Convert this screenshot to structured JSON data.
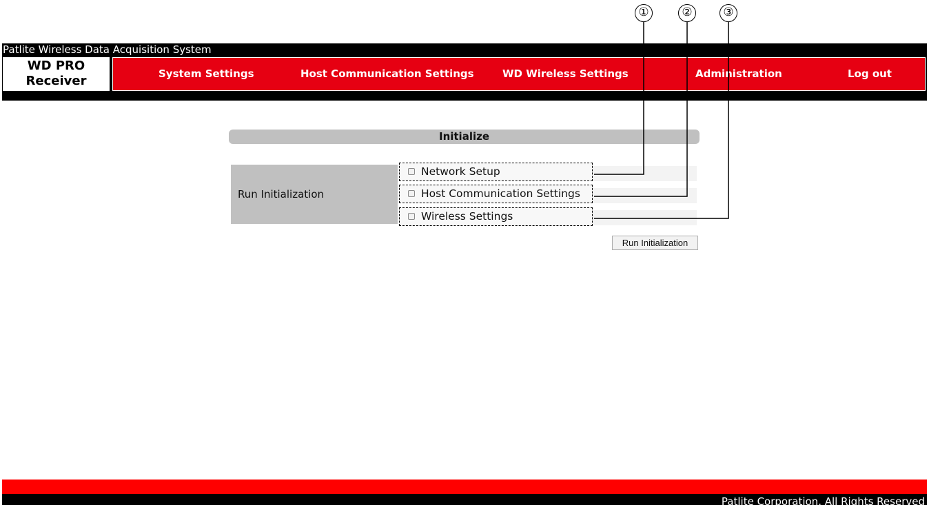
{
  "window": {
    "title": "Patlite Wireless Data Acquisition System"
  },
  "brand": {
    "line1": "WD PRO",
    "line2": "Receiver"
  },
  "nav": {
    "items": [
      {
        "label": "System Settings"
      },
      {
        "label": "Host Communication Settings"
      },
      {
        "label": "WD Wireless Settings"
      },
      {
        "label": "Administration"
      },
      {
        "label": "Log out"
      }
    ]
  },
  "callouts": [
    "①",
    "②",
    "③"
  ],
  "section": {
    "title": "Initialize"
  },
  "form": {
    "label": "Run Initialization",
    "options": [
      {
        "label": "Network Setup",
        "checked": false
      },
      {
        "label": "Host Communication Settings",
        "checked": false
      },
      {
        "label": "Wireless Settings",
        "checked": false
      }
    ],
    "submit_label": "Run Initialization"
  },
  "footer": {
    "text": "Patlite Corporation. All Rights Reserved"
  },
  "colors": {
    "nav_red": "#e60012",
    "footer_red": "#ff0000",
    "header_black": "#000000",
    "section_gray": "#c0c0c0"
  }
}
